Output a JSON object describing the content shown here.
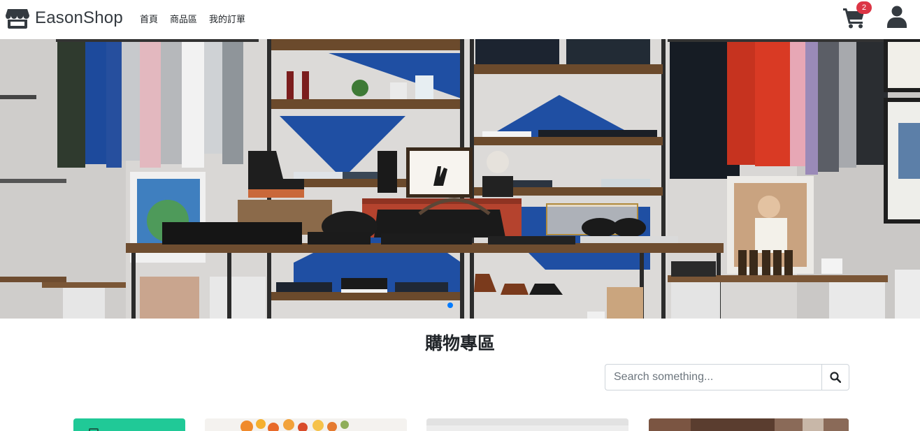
{
  "brand": {
    "name": "EasonShop"
  },
  "nav": {
    "items": [
      {
        "label": "首頁"
      },
      {
        "label": "商品區"
      },
      {
        "label": "我的訂單"
      }
    ]
  },
  "cart": {
    "count": "2"
  },
  "hero": {
    "active_slide": 1,
    "slide_count": 1
  },
  "section": {
    "title": "購物專區"
  },
  "search": {
    "placeholder": "Search something..."
  },
  "icons": {
    "brand": "store-icon",
    "cart": "shopping-cart-icon",
    "user": "user-icon",
    "search": "search-icon"
  },
  "colors": {
    "brand_text": "#343a40",
    "badge": "#dc3545",
    "carousel_indicator": "#007bff",
    "category_card": "#20c997"
  }
}
